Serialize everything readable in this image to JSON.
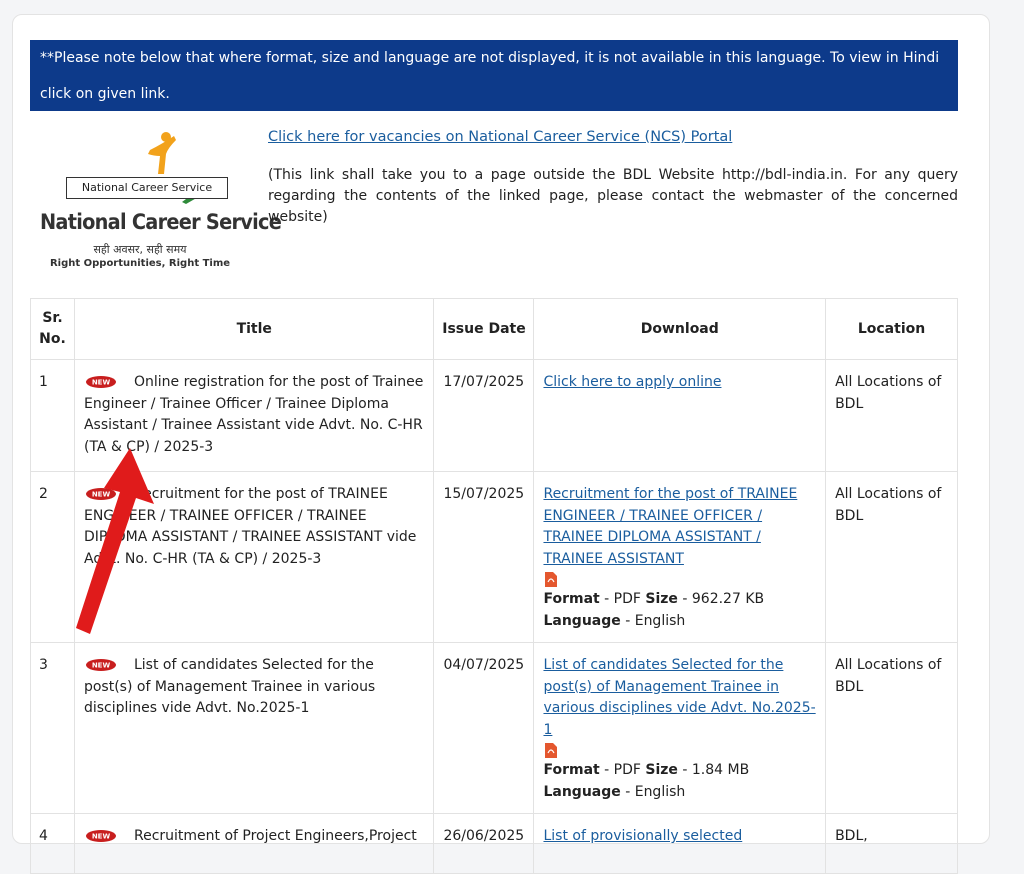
{
  "notice": "**Please note below that where format, size and language are not displayed, it is not available in this language. To view in Hindi click on given link.",
  "ncs": {
    "link": "Click here for vacancies on National Career Service (NCS) Portal",
    "note": "(This link shall take you to a page outside the BDL Website http://bdl-india.in. For any query regarding the contents of the linked page, please contact the webmaster of the concerned website)",
    "logo_tag": "National Career Service",
    "logo_title": "National Career Service",
    "logo_hindi": "सही अवसर, सही समय",
    "logo_tagline": "Right Opportunities, Right Time"
  },
  "table": {
    "headers": {
      "sr": "Sr. No.",
      "title": "Title",
      "date": "Issue Date",
      "download": "Download",
      "location": "Location"
    },
    "badge_text": "NEW",
    "rows": [
      {
        "sr": "1",
        "title": "Online registration for the post of Trainee Engineer / Trainee Officer / Trainee Diploma Assistant / Trainee Assistant vide Advt. No. C-HR (TA & CP) / 2025-3",
        "date": "17/07/2025",
        "link": "Click here to apply online",
        "location": "All Locations of BDL"
      },
      {
        "sr": "2",
        "title": "Recruitment for the post of TRAINEE ENGINEER / TRAINEE OFFICER / TRAINEE DIPLOMA ASSISTANT / TRAINEE ASSISTANT  vide Advt. No. C-HR (TA & CP) / 2025-3",
        "date": "15/07/2025",
        "link": "Recruitment for the post of TRAINEE ENGINEER / TRAINEE OFFICER / TRAINEE DIPLOMA ASSISTANT / TRAINEE ASSISTANT",
        "format_label": "Format",
        "format_value": " - PDF ",
        "size_label": "Size",
        "size_value": " - 962.27 KB",
        "lang_label": "Language",
        "lang_value": " - English",
        "location": "All Locations of BDL"
      },
      {
        "sr": "3",
        "title": "List of candidates Selected for the post(s) of Management Trainee in various disciplines vide Advt. No.2025-1",
        "date": "04/07/2025",
        "link": "List of candidates Selected for the post(s) of Management Trainee in various disciplines vide Advt. No.2025-1",
        "format_label": "Format",
        "format_value": " - PDF ",
        "size_label": "Size",
        "size_value": " - 1.84 MB ",
        "lang_label": "Language",
        "lang_value": " - English",
        "location": "All Locations of BDL"
      },
      {
        "sr": "4",
        "title": "Recruitment of Project Engineers,Project",
        "date": "26/06/2025",
        "link": "List of provisionally selected",
        "location": "BDL,"
      }
    ]
  }
}
